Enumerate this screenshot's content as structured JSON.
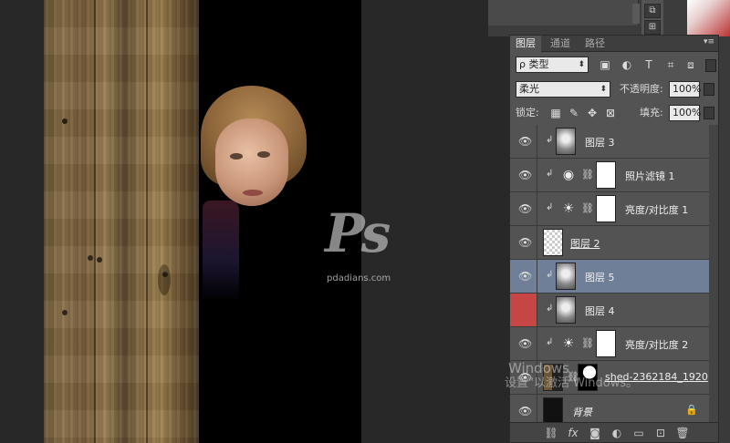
{
  "panel": {
    "tabs": [
      "图层",
      "通道",
      "路径"
    ],
    "menu_glyph": "▾≡"
  },
  "filter": {
    "value": "ρ 类型",
    "arrow": "⬍"
  },
  "blend": {
    "mode": "柔光",
    "arrow": "⬍",
    "opacity_label": "不透明度:",
    "opacity": "100%"
  },
  "lock": {
    "label": "锁定:",
    "fill_label": "填充:",
    "fill": "100%"
  },
  "layers": [
    {
      "name": "图层 3",
      "thumb": "gray",
      "clip": true,
      "selected": false,
      "visible": true,
      "red": false
    },
    {
      "name": "照片滤镜 1",
      "thumb": "white",
      "clip": true,
      "adj": "camera",
      "selected": false,
      "visible": true,
      "red": false
    },
    {
      "name": "亮度/对比度 1",
      "thumb": "white",
      "clip": true,
      "adj": "sun",
      "selected": false,
      "visible": true,
      "red": false
    },
    {
      "name": "图层 2",
      "thumb": "checker",
      "clip": false,
      "selected": false,
      "visible": true,
      "red": false
    },
    {
      "name": "图层 5",
      "thumb": "gray",
      "clip": true,
      "selected": true,
      "visible": true,
      "red": false
    },
    {
      "name": "图层 4",
      "thumb": "gray",
      "clip": true,
      "selected": false,
      "visible": true,
      "red": true
    },
    {
      "name": "亮度/对比度 2",
      "thumb": "white",
      "clip": true,
      "adj": "sun",
      "selected": false,
      "visible": true,
      "red": false
    },
    {
      "name": "shed-2362184_1920",
      "thumb": "photo",
      "clip": false,
      "mask": true,
      "selected": false,
      "visible": true,
      "red": false
    },
    {
      "name": "背景",
      "thumb": "dark",
      "clip": false,
      "locked": true,
      "selected": false,
      "visible": true,
      "red": false
    }
  ],
  "watermark": {
    "url": "pdadians.com"
  },
  "windows": {
    "title": "Windows",
    "subtitle": "设置\"以激活 Windows。"
  },
  "icons": {
    "eye": "👁",
    "clip": "↲",
    "link": "⛓",
    "sun": "☀",
    "camera": "◉",
    "lock": "🔒"
  },
  "colors": {
    "panel": "#535353",
    "selected": "#6f7f97",
    "red_eye": "#c64545"
  }
}
